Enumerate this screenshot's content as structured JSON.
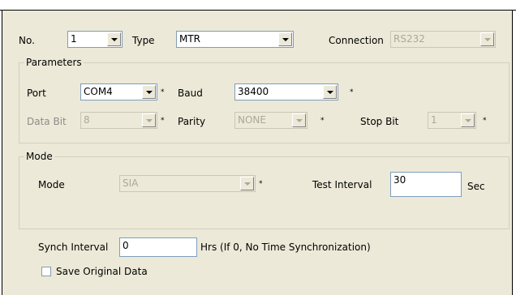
{
  "form": {
    "no_label": "No.",
    "no_value": "1",
    "type_label": "Type",
    "type_value": "MTR",
    "connection_label": "Connection",
    "connection_value": "RS232"
  },
  "parameters": {
    "title": "Parameters",
    "port_label": "Port",
    "port_value": "COM4",
    "baud_label": "Baud",
    "baud_value": "38400",
    "data_bit_label": "Data Bit",
    "data_bit_value": "8",
    "parity_label": "Parity",
    "parity_value": "NONE",
    "stop_bit_label": "Stop Bit",
    "stop_bit_value": "1",
    "required_mark": "*"
  },
  "mode": {
    "title": "Mode",
    "mode_label": "Mode",
    "mode_value": "SIA",
    "test_interval_label": "Test Interval",
    "test_interval_value": "30",
    "test_interval_unit": "Sec",
    "required_mark": "*"
  },
  "synch": {
    "label": "Synch Interval",
    "value": "0",
    "hint": "Hrs (If 0, No Time Synchronization)"
  },
  "save_original": {
    "label": "Save Original Data",
    "checked": false
  }
}
